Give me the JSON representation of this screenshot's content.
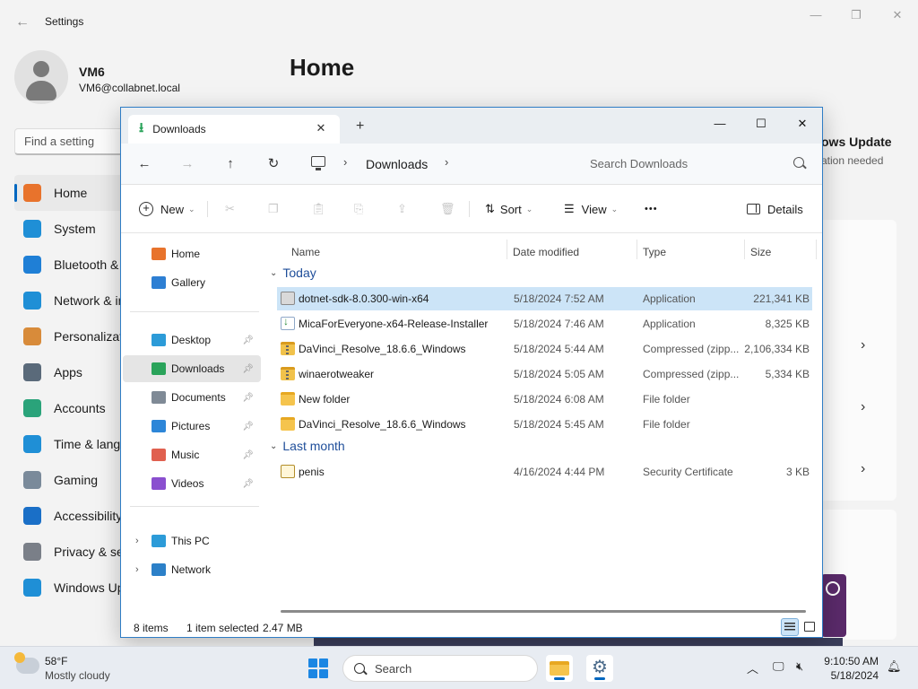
{
  "settings": {
    "window_title": "Settings",
    "user_name": "VM6",
    "user_email": "VM6@collabnet.local",
    "search_placeholder": "Find a setting",
    "page_title": "Home",
    "nav": [
      {
        "label": "Home",
        "icon": "home-icon",
        "color": "#e8732c"
      },
      {
        "label": "System",
        "icon": "system-icon",
        "color": "#1f8fd6"
      },
      {
        "label": "Bluetooth & devices",
        "icon": "bluetooth-icon",
        "color": "#1f7fd6"
      },
      {
        "label": "Network & internet",
        "icon": "wifi-icon",
        "color": "#1f8fd6"
      },
      {
        "label": "Personalization",
        "icon": "brush-icon",
        "color": "#d88b3a"
      },
      {
        "label": "Apps",
        "icon": "apps-icon",
        "color": "#5a6a7a"
      },
      {
        "label": "Accounts",
        "icon": "accounts-icon",
        "color": "#2aa37a"
      },
      {
        "label": "Time & language",
        "icon": "clock-icon",
        "color": "#1f8fd6"
      },
      {
        "label": "Gaming",
        "icon": "gamepad-icon",
        "color": "#7a8a9a"
      },
      {
        "label": "Accessibility",
        "icon": "accessibility-icon",
        "color": "#1a6fc7"
      },
      {
        "label": "Privacy & security",
        "icon": "shield-icon",
        "color": "#7a7f88"
      },
      {
        "label": "Windows Update",
        "icon": "update-icon",
        "color": "#1f8fd6"
      }
    ],
    "update_title": "ows Update",
    "update_sub": "ation needed"
  },
  "explorer": {
    "tab_title": "Downloads",
    "breadcrumb": "Downloads",
    "search_placeholder": "Search Downloads",
    "toolbar": {
      "new_label": "New",
      "sort_label": "Sort",
      "view_label": "View",
      "more_label": "•••",
      "details_label": "Details"
    },
    "sidebar": {
      "top": [
        {
          "label": "Home",
          "icon": "home-icon",
          "color": "#e8732c"
        },
        {
          "label": "Gallery",
          "icon": "gallery-icon",
          "color": "#2d7fd3"
        }
      ],
      "quick": [
        {
          "label": "Desktop",
          "icon": "desktop-icon",
          "color": "#2c9bd8",
          "pinned": true
        },
        {
          "label": "Downloads",
          "icon": "download-icon",
          "color": "#2aa35a",
          "pinned": true
        },
        {
          "label": "Documents",
          "icon": "documents-icon",
          "color": "#7f8a96",
          "pinned": true
        },
        {
          "label": "Pictures",
          "icon": "pictures-icon",
          "color": "#2d86d8",
          "pinned": true
        },
        {
          "label": "Music",
          "icon": "music-icon",
          "color": "#e0604f",
          "pinned": true
        },
        {
          "label": "Videos",
          "icon": "videos-icon",
          "color": "#8a4fcf",
          "pinned": true
        }
      ],
      "drives": [
        {
          "label": "This PC",
          "icon": "pc-icon",
          "color": "#2c9bd8"
        },
        {
          "label": "Network",
          "icon": "network-icon",
          "color": "#2c80c8"
        }
      ]
    },
    "columns": {
      "name": "Name",
      "date": "Date modified",
      "type": "Type",
      "size": "Size"
    },
    "groups": [
      {
        "label": "Today",
        "files": [
          {
            "name": "dotnet-sdk-8.0.300-win-x64",
            "date": "5/18/2024 7:52 AM",
            "type": "Application",
            "size": "221,341 KB",
            "icon": "app",
            "selected": true
          },
          {
            "name": "MicaForEveryone-x64-Release-Installer",
            "date": "5/18/2024 7:46 AM",
            "type": "Application",
            "size": "8,325 KB",
            "icon": "installer",
            "selected": false
          },
          {
            "name": "DaVinci_Resolve_18.6.6_Windows",
            "date": "5/18/2024 5:44 AM",
            "type": "Compressed (zipp...",
            "size": "2,106,334 KB",
            "icon": "zip",
            "selected": false
          },
          {
            "name": "winaerotweaker",
            "date": "5/18/2024 5:05 AM",
            "type": "Compressed (zipp...",
            "size": "5,334 KB",
            "icon": "zip",
            "selected": false
          },
          {
            "name": "New folder",
            "date": "5/18/2024 6:08 AM",
            "type": "File folder",
            "size": "",
            "icon": "folder",
            "selected": false
          },
          {
            "name": "DaVinci_Resolve_18.6.6_Windows",
            "date": "5/18/2024 5:45 AM",
            "type": "File folder",
            "size": "",
            "icon": "folder",
            "selected": false
          }
        ]
      },
      {
        "label": "Last month",
        "files": [
          {
            "name": "penis",
            "date": "4/16/2024 4:44 PM",
            "type": "Security Certificate",
            "size": "3 KB",
            "icon": "cert",
            "selected": false
          }
        ]
      }
    ],
    "status": {
      "count": "8 items",
      "selected": "1 item selected",
      "size": "2.47 MB"
    }
  },
  "taskbar": {
    "temperature": "58°F",
    "condition": "Mostly cloudy",
    "search_label": "Search",
    "time": "9:10:50 AM",
    "date": "5/18/2024"
  }
}
